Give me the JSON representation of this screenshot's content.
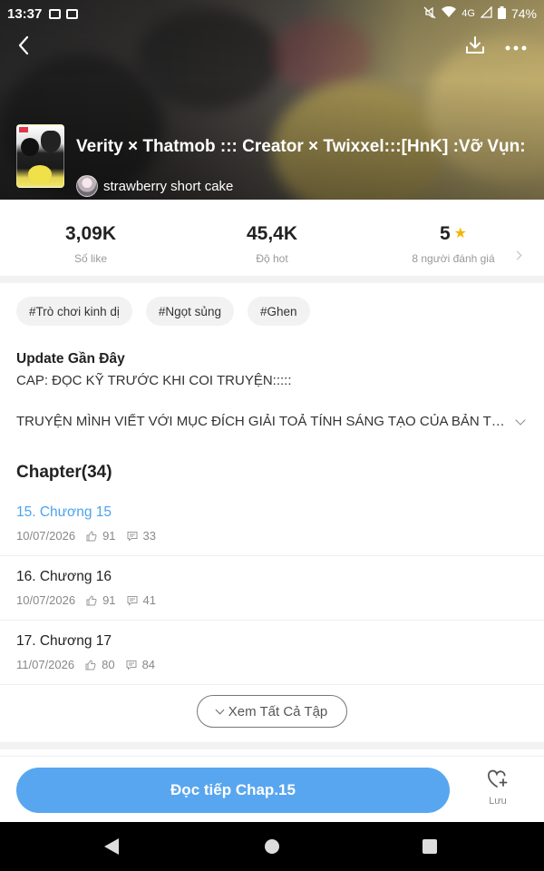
{
  "status_bar": {
    "time": "13:37",
    "network": "4G",
    "battery": "74%"
  },
  "header": {
    "title": "Verity × Thatmob ::: Creator × Twixxel:::[HnK] :Vỡ Vụn:",
    "author": "strawberry short cake",
    "icons": [
      "back-arrow-icon",
      "download-icon",
      "more-icon"
    ]
  },
  "stats": {
    "likes_value": "3,09K",
    "likes_label": "Số like",
    "hot_value": "45,4K",
    "hot_label": "Độ hot",
    "rating_value": "5",
    "rating_label": "8 người đánh giá"
  },
  "tags": [
    "#Trò chơi kinh dị",
    "#Ngọt sủng",
    "#Ghen"
  ],
  "update": {
    "title": "Update Gần Đây",
    "text": "CAP: ĐỌC KỸ TRƯỚC KHI COI TRUYỆN:::::"
  },
  "description": "TRUYỆN MÌNH VIẾT VỚI MỤC ĐÍCH GIẢI TOẢ TÍNH SÁNG TẠO CỦA BẢN THÂN",
  "chapters": {
    "heading": "Chapter(34)",
    "items": [
      {
        "name": "15. Chương 15",
        "date": "10/07/2026",
        "likes": "91",
        "comments": "33",
        "active": true
      },
      {
        "name": "16. Chương 16",
        "date": "10/07/2026",
        "likes": "91",
        "comments": "41",
        "active": false
      },
      {
        "name": "17. Chương 17",
        "date": "11/07/2026",
        "likes": "80",
        "comments": "84",
        "active": false
      }
    ],
    "see_all_label": "Xem Tất Cả Tập"
  },
  "bottom": {
    "read_label": "Đọc tiếp Chap.15",
    "save_label": "Lưu"
  },
  "colors": {
    "accent": "#58a6ef",
    "active_chapter": "#4aa3f0",
    "star": "#f5b400"
  }
}
